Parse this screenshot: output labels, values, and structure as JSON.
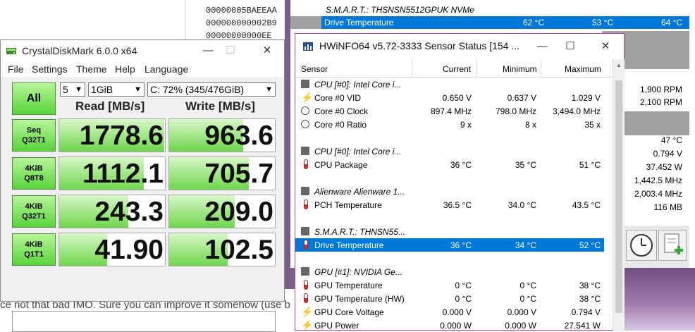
{
  "background": {
    "hex_values": [
      "00000005BAEEAA",
      "000000000002B9",
      "00000000000EE"
    ],
    "article_text": "ce not that bad IMO. Sure you can improve it somehow (use b",
    "bg_hwinfo": {
      "group_title": "S.M.A.R.T.: THSNSN5512GPUK NVMe ...",
      "selected_row": {
        "label": "Drive Temperature",
        "current": "62 °C",
        "min": "53 °C",
        "max": "64 °C"
      },
      "side_values": [
        "1,900 RPM",
        "2,100 RPM",
        "47 °C",
        "0.794 V",
        "37.452 W",
        "1,442.5 MHz",
        "2,003.4 MHz",
        "116 MB"
      ]
    }
  },
  "cdm": {
    "title": "CrystalDiskMark 6.0.0 x64",
    "menu": [
      "File",
      "Settings",
      "Theme",
      "Help",
      "Language"
    ],
    "all_label": "All",
    "count": "5",
    "size": "1GiB",
    "drive": "C: 72% (345/476GiB)",
    "read_header": "Read [MB/s]",
    "write_header": "Write [MB/s]",
    "rows": [
      {
        "line1": "Seq",
        "line2": "Q32T1",
        "read": "1778.6",
        "write": "963.6",
        "read_frac": 0.99,
        "write_frac": 0.7
      },
      {
        "line1": "4KiB",
        "line2": "Q8T8",
        "read": "1112.1",
        "write": "705.7",
        "read_frac": 0.8,
        "write_frac": 0.75
      },
      {
        "line1": "4KiB",
        "line2": "Q32T1",
        "read": "243.3",
        "write": "209.0",
        "read_frac": 0.65,
        "write_frac": 0.62
      },
      {
        "line1": "4KiB",
        "line2": "Q1T1",
        "read": "41.90",
        "write": "102.5",
        "read_frac": 0.45,
        "write_frac": 0.55
      }
    ],
    "colors": {
      "button_green": "#58d43a",
      "bar_green": "#6fd64d"
    }
  },
  "hwinfo": {
    "title": "HWiNFO64 v5.72-3333 Sensor Status [154 ...",
    "headers": {
      "sensor": "Sensor",
      "current": "Current",
      "minimum": "Minimum",
      "maximum": "Maximum"
    },
    "rows": [
      {
        "type": "group",
        "icon": "chip-icon",
        "label": "CPU [#0]: Intel Core i...",
        "cur": "",
        "min": "",
        "max": ""
      },
      {
        "type": "item",
        "icon": "voltage-icon",
        "label": "Core #0 VID",
        "cur": "0.650 V",
        "min": "0.637 V",
        "max": "1.029 V"
      },
      {
        "type": "item",
        "icon": "clock-icon",
        "label": "Core #0 Clock",
        "cur": "897.4 MHz",
        "min": "798.0 MHz",
        "max": "3,494.0 MHz"
      },
      {
        "type": "item",
        "icon": "clock-icon",
        "label": "Core #0 Ratio",
        "cur": "9 x",
        "min": "8 x",
        "max": "35 x"
      },
      {
        "type": "spacer"
      },
      {
        "type": "group",
        "icon": "chip-icon",
        "label": "CPU [#0]: Intel Core i...",
        "cur": "",
        "min": "",
        "max": ""
      },
      {
        "type": "item",
        "icon": "thermometer-icon",
        "label": "CPU Package",
        "cur": "36 °C",
        "min": "35 °C",
        "max": "51 °C"
      },
      {
        "type": "spacer"
      },
      {
        "type": "group",
        "icon": "chip-icon",
        "label": "Alienware Alienware 1...",
        "cur": "",
        "min": "",
        "max": ""
      },
      {
        "type": "item",
        "icon": "thermometer-icon",
        "label": "PCH Temperature",
        "cur": "36.5 °C",
        "min": "34.0 °C",
        "max": "43.5 °C"
      },
      {
        "type": "spacer"
      },
      {
        "type": "group",
        "icon": "chip-icon",
        "label": "S.M.A.R.T.: THNSN55...",
        "cur": "",
        "min": "",
        "max": ""
      },
      {
        "type": "item",
        "icon": "thermometer-icon",
        "label": "Drive Temperature",
        "cur": "36 °C",
        "min": "34 °C",
        "max": "52 °C",
        "selected": true
      },
      {
        "type": "spacer"
      },
      {
        "type": "group",
        "icon": "chip-icon",
        "label": "GPU [#1]: NVIDIA Ge...",
        "cur": "",
        "min": "",
        "max": ""
      },
      {
        "type": "item",
        "icon": "thermometer-icon",
        "label": "GPU Temperature",
        "cur": "0 °C",
        "min": "0 °C",
        "max": "38 °C"
      },
      {
        "type": "item",
        "icon": "thermometer-icon",
        "label": "GPU Temperature (HW)",
        "cur": "0 °C",
        "min": "0 °C",
        "max": "38 °C"
      },
      {
        "type": "item",
        "icon": "voltage-icon",
        "label": "GPU Core Voltage",
        "cur": "0.000 V",
        "min": "0.000 V",
        "max": "0.794 V"
      },
      {
        "type": "item",
        "icon": "voltage-icon",
        "label": "GPU Power",
        "cur": "0.000 W",
        "min": "0.000 W",
        "max": "27.541 W"
      }
    ],
    "colors": {
      "selection": "#0078d7",
      "border": "#b04a9e"
    }
  }
}
